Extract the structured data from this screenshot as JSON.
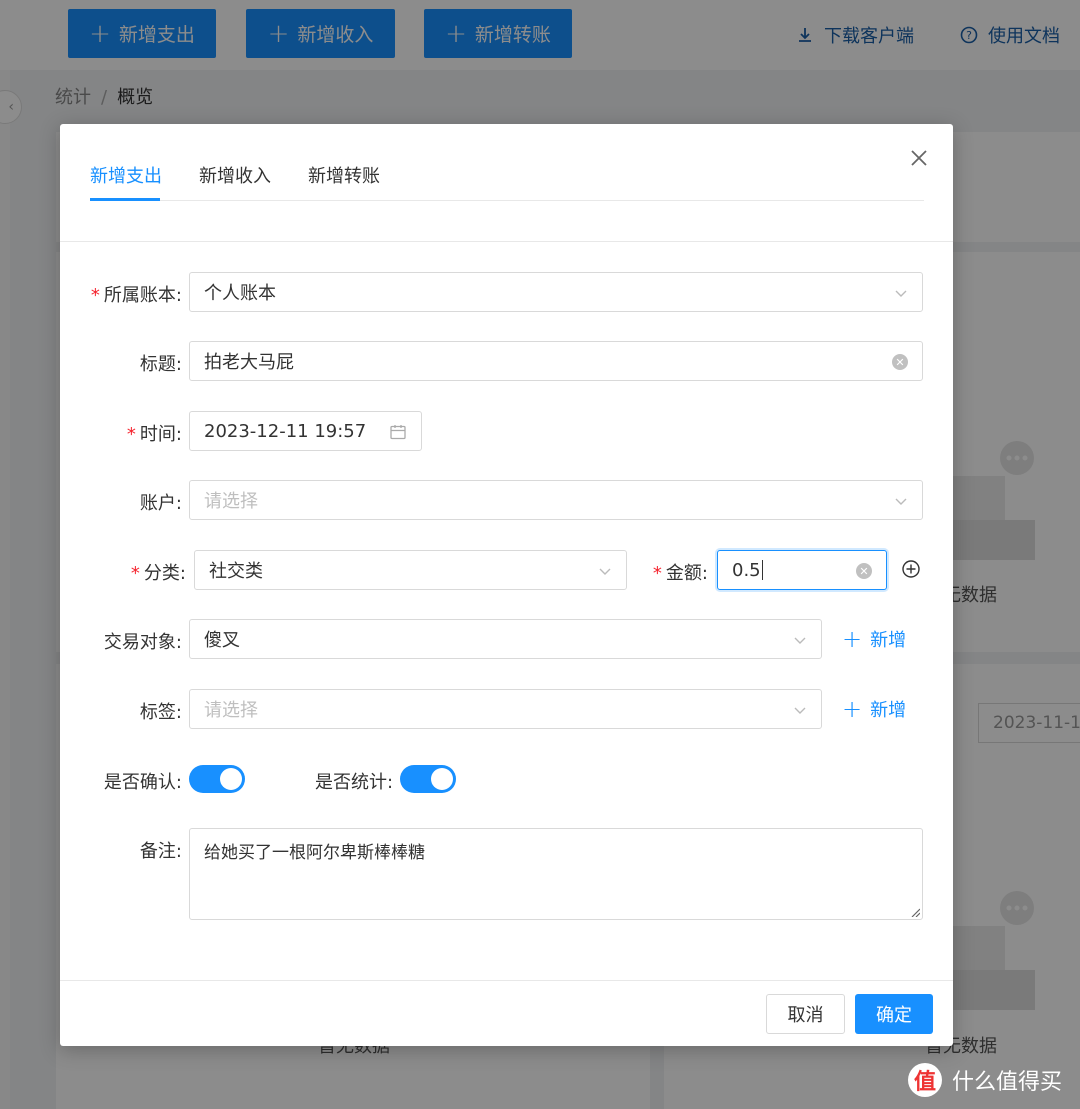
{
  "topbar": {
    "buttons": [
      "新增支出",
      "新增收入",
      "新增转账"
    ],
    "download_label": "下载客户端",
    "docs_label": "使用文档"
  },
  "breadcrumb": {
    "parent": "统计",
    "separator": "/",
    "current": "概览"
  },
  "background": {
    "empty_text": "暂无数据",
    "date_value": "2023-11-1"
  },
  "modal": {
    "tabs": [
      "新增支出",
      "新增收入",
      "新增转账"
    ],
    "active_tab": 0,
    "form": {
      "book": {
        "label": "所属账本",
        "value": "个人账本",
        "required": true
      },
      "title": {
        "label": "标题",
        "value": "拍老大马屁"
      },
      "time": {
        "label": "时间",
        "value": "2023-12-11 19:57",
        "required": true
      },
      "account": {
        "label": "账户",
        "placeholder": "请选择"
      },
      "category": {
        "label": "分类",
        "value": "社交类",
        "required": true
      },
      "amount": {
        "label": "金额",
        "value": "0.5",
        "required": true
      },
      "counterparty": {
        "label": "交易对象",
        "value": "傻叉",
        "add_label": "新增"
      },
      "tags": {
        "label": "标签",
        "placeholder": "请选择",
        "add_label": "新增"
      },
      "confirmed": {
        "label": "是否确认",
        "on": true
      },
      "counted": {
        "label": "是否统计",
        "on": true
      },
      "note": {
        "label": "备注",
        "value": "给她买了一根阿尔卑斯棒棒糖"
      }
    },
    "cancel_label": "取消",
    "ok_label": "确定"
  },
  "watermark": {
    "logo": "值",
    "text": "什么值得买"
  },
  "colors": {
    "primary": "#1890ff",
    "required": "#f5222d",
    "overlay": "rgba(0,0,0,0.45)"
  }
}
